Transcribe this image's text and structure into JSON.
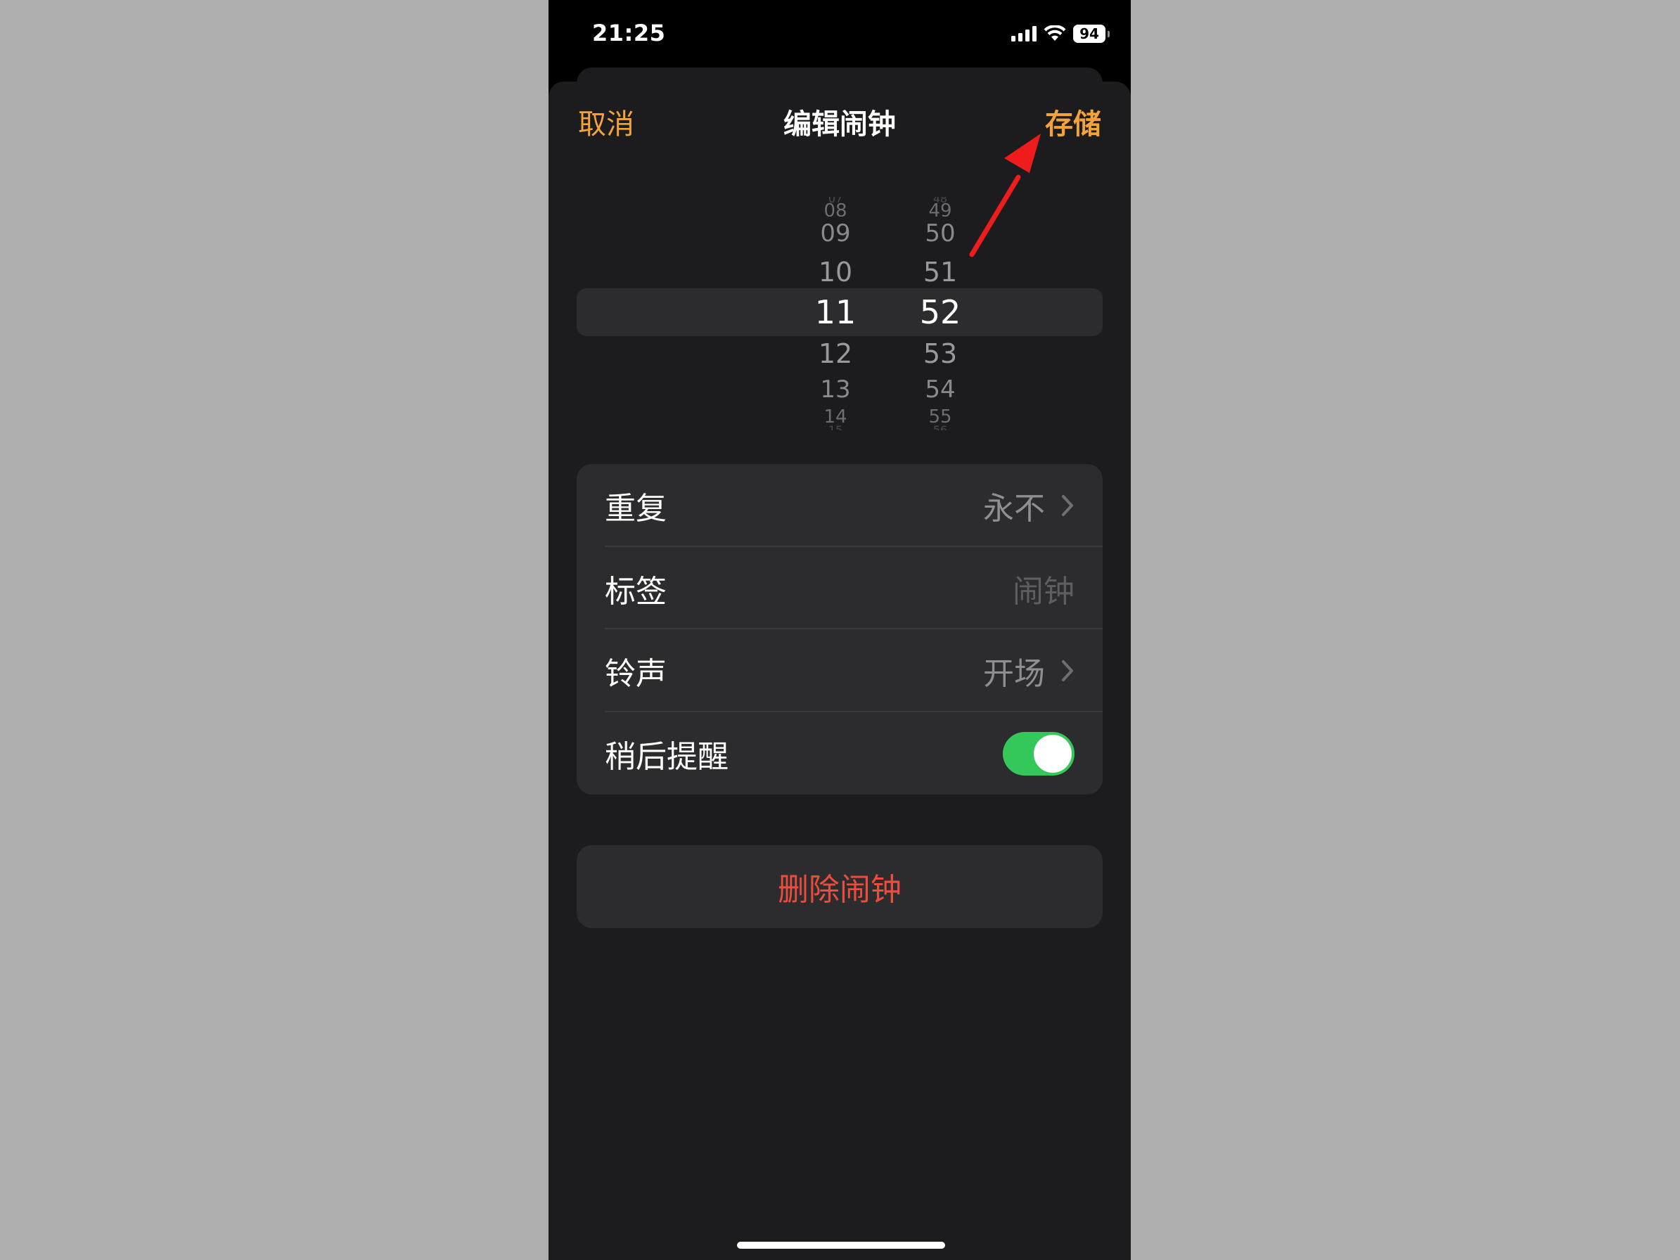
{
  "status_bar": {
    "time": "21:25",
    "battery": "94",
    "signal_icon": "cellular-signal-icon",
    "wifi_icon": "wifi-icon"
  },
  "nav": {
    "cancel_label": "取消",
    "title": "编辑闹钟",
    "save_label": "存储"
  },
  "picker": {
    "hours": [
      "07",
      "08",
      "09",
      "10",
      "11",
      "12",
      "13",
      "14",
      "15"
    ],
    "minutes": [
      "48",
      "49",
      "50",
      "51",
      "52",
      "53",
      "54",
      "55",
      "56"
    ],
    "selected_hour": "11",
    "selected_minute": "52"
  },
  "settings": {
    "repeat": {
      "label": "重复",
      "value": "永不"
    },
    "label": {
      "label": "标签",
      "placeholder": "闹钟"
    },
    "sound": {
      "label": "铃声",
      "value": "开场"
    },
    "snooze": {
      "label": "稍后提醒",
      "on": true
    }
  },
  "delete_label": "删除闹钟",
  "colors": {
    "accent": "#f2a33a",
    "destructive": "#eb4d3d",
    "toggle_on": "#34c759",
    "annotation_arrow": "#ee1c1c"
  }
}
